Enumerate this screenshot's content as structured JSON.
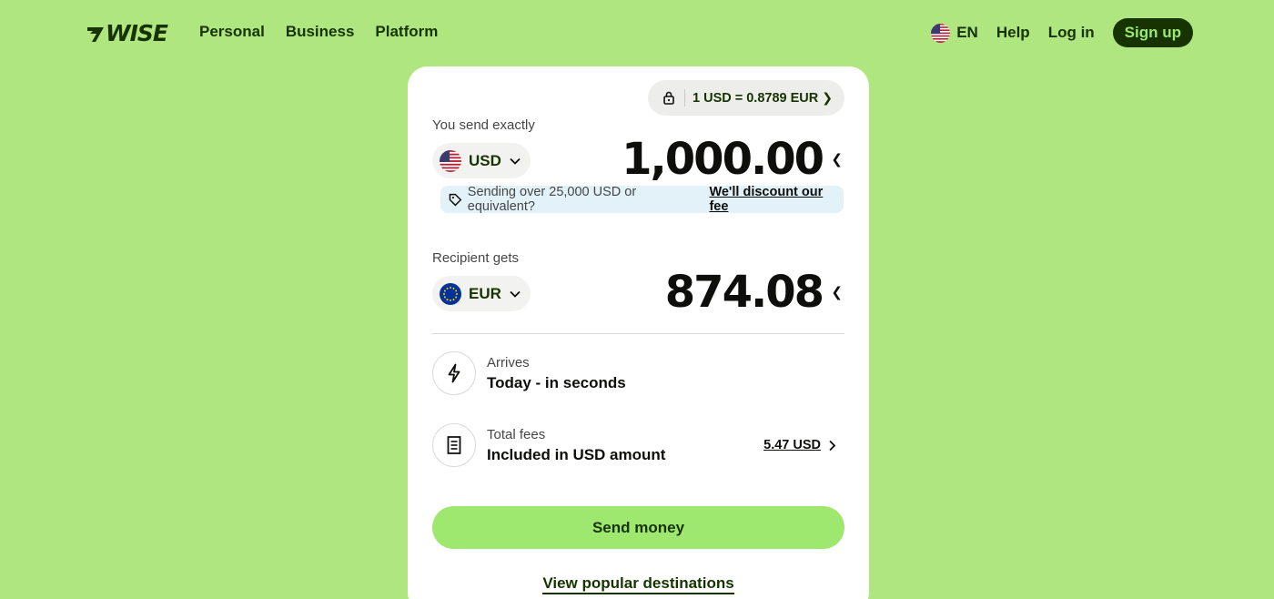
{
  "header": {
    "logo_text": "WISE",
    "nav": [
      "Personal",
      "Business",
      "Platform"
    ],
    "language": "EN",
    "help": "Help",
    "login": "Log in",
    "signup": "Sign up"
  },
  "converter": {
    "rate_text": "1 USD = 0.8789 EUR",
    "send_label": "You send exactly",
    "send_currency": "USD",
    "send_amount": "1,000.00",
    "discount_text": "Sending over 25,000 USD or equivalent?",
    "discount_link": "We'll discount our fee",
    "receive_label": "Recipient gets",
    "receive_currency": "EUR",
    "receive_amount": "874.08",
    "arrives_label": "Arrives",
    "arrives_value": "Today - in seconds",
    "fees_label": "Total fees",
    "fees_value": "Included in USD amount",
    "fees_amount": "5.47 USD",
    "send_button": "Send money",
    "popular_link": "View popular destinations"
  },
  "colors": {
    "background": "#b0e67f",
    "brand_dark": "#163300",
    "brand_green": "#9fe870",
    "discount_bg": "#e3f1f9"
  },
  "icons": {
    "lock": "lock-icon",
    "arrives": "lightning-icon",
    "fees": "receipt-icon",
    "discount": "tag-icon"
  }
}
